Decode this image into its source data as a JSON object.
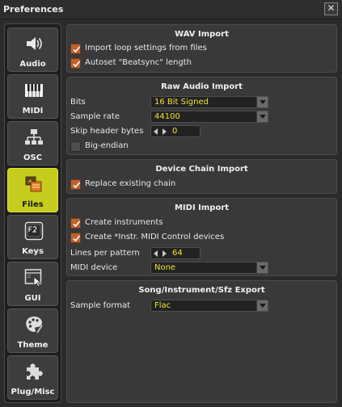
{
  "window": {
    "title": "Preferences",
    "close_glyph": "✕"
  },
  "sidebar": {
    "items": [
      {
        "label": "Audio",
        "icon": "speaker-icon",
        "active": false
      },
      {
        "label": "MIDI",
        "icon": "piano-keys-icon",
        "active": false
      },
      {
        "label": "OSC",
        "icon": "network-tree-icon",
        "active": false
      },
      {
        "label": "Files",
        "icon": "folder-stack-icon",
        "active": true
      },
      {
        "label": "Keys",
        "icon": "f2-key-icon",
        "active": false
      },
      {
        "label": "GUI",
        "icon": "window-cursor-icon",
        "active": false
      },
      {
        "label": "Theme",
        "icon": "palette-icon",
        "active": false
      },
      {
        "label": "Plug/Misc",
        "icon": "puzzle-icon",
        "active": false
      }
    ]
  },
  "wav_import": {
    "title": "WAV Import",
    "import_loop_settings": {
      "label": "Import loop settings from files",
      "checked": true
    },
    "autoset_beatsync": {
      "label": "Autoset \"Beatsync\" length",
      "checked": true
    }
  },
  "raw_audio_import": {
    "title": "Raw Audio Import",
    "bits": {
      "label": "Bits",
      "value": "16 Bit Signed"
    },
    "sample_rate": {
      "label": "Sample rate",
      "value": "44100"
    },
    "skip_header": {
      "label": "Skip header bytes",
      "value": "0"
    },
    "big_endian": {
      "label": "Big-endian",
      "checked": false
    }
  },
  "device_chain_import": {
    "title": "Device Chain Import",
    "replace_chain": {
      "label": "Replace existing chain",
      "checked": true
    }
  },
  "midi_import": {
    "title": "MIDI Import",
    "create_instruments": {
      "label": "Create instruments",
      "checked": true
    },
    "create_instr_midi": {
      "label": "Create *Instr. MIDI Control devices",
      "checked": true
    },
    "lines_per_pattern": {
      "label": "Lines per pattern",
      "value": "64"
    },
    "midi_device": {
      "label": "MIDI device",
      "value": "None"
    }
  },
  "export": {
    "title": "Song/Instrument/Sfz Export",
    "sample_format": {
      "label": "Sample format",
      "value": "Flac"
    }
  },
  "colors": {
    "accent_active": "#c6cd1f",
    "checkbox_on": "#c0622e",
    "value_text": "#f2e233"
  }
}
